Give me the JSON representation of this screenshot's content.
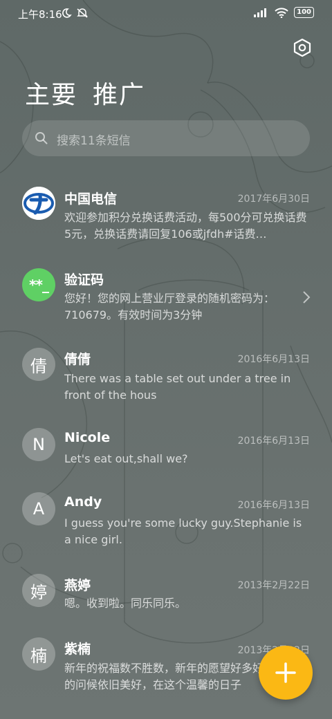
{
  "status_bar": {
    "time": "上午8:16",
    "battery": "100",
    "icons": [
      "moon-icon",
      "mute-icon",
      "signal-icon",
      "wifi-icon",
      "battery-icon"
    ]
  },
  "header": {
    "tabs": [
      {
        "label": "主要",
        "selected": true
      },
      {
        "label": "推广",
        "selected": false
      }
    ],
    "settings_icon": "hexagon-settings-icon"
  },
  "search": {
    "placeholder": "搜索11条短信"
  },
  "conversations": [
    {
      "name": "中国电信",
      "date": "2017年6月30日",
      "preview": "欢迎参加积分兑换话费活动，每500分可兑换话费5元，兑换话费请回复106或jfdh#话费…",
      "avatar": "",
      "avatar_type": "china-telecom-logo"
    },
    {
      "name": "验证码",
      "date": "",
      "preview": "您好！您的网上营业厅登录的随机密码为：710679。有效时间为3分钟",
      "avatar": "**_",
      "avatar_type": "verification-code"
    },
    {
      "name": "倩倩",
      "date": "2016年6月13日",
      "preview": "There was a table set out under a tree in front of the hous",
      "avatar": "倩",
      "avatar_type": "initial"
    },
    {
      "name": "Nicole",
      "date": "2016年6月13日",
      "preview": "Let's eat out,shall we?",
      "avatar": "N",
      "avatar_type": "initial"
    },
    {
      "name": "Andy",
      "date": "2016年6月13日",
      "preview": "I guess you're some lucky guy.Stephanie is a nice girl.",
      "avatar": "A",
      "avatar_type": "initial"
    },
    {
      "name": "燕婷",
      "date": "2013年2月22日",
      "preview": "嗯。收到啦。同乐同乐。",
      "avatar": "婷",
      "avatar_type": "initial"
    },
    {
      "name": "紫楠",
      "date": "2013年2月22日",
      "preview": "新年的祝福数不胜数，新年的愿望好多好多，新年的问候依旧美好，在这个温馨的日子",
      "avatar": "楠",
      "avatar_type": "initial"
    }
  ],
  "fab": {
    "icon": "plus-icon",
    "color": "#fbb814"
  }
}
